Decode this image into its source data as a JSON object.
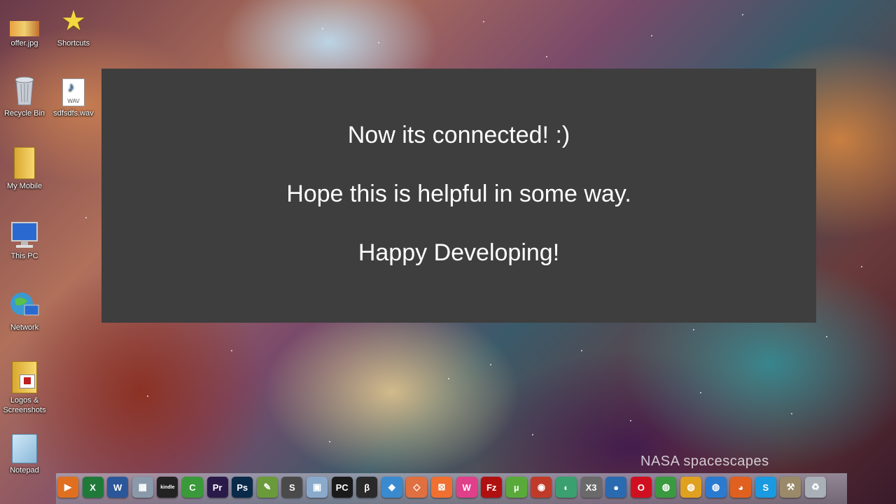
{
  "desktop": {
    "icons": [
      {
        "label": "offer.jpg"
      },
      {
        "label": "Shortcuts"
      },
      {
        "label": "Recycle Bin"
      },
      {
        "label": "sdfsdfs.wav"
      },
      {
        "label": "My Mobile"
      },
      {
        "label": "This PC"
      },
      {
        "label": "Network"
      },
      {
        "label": "Logos & Screenshots"
      },
      {
        "label": "Notepad"
      }
    ],
    "wav_badge": "WAV"
  },
  "overlay": {
    "line1": "Now its connected! :)",
    "line2": "Hope this is helpful in some way.",
    "line3": "Happy Developing!"
  },
  "watermark": "NASA spacescapes",
  "dock": {
    "items": [
      {
        "name": "media-player-icon",
        "text": "▶",
        "color": "#e07020"
      },
      {
        "name": "excel-icon",
        "text": "X",
        "color": "#1f7a3a"
      },
      {
        "name": "word-icon",
        "text": "W",
        "color": "#2b579a"
      },
      {
        "name": "calculator-icon",
        "text": "▦",
        "color": "#8a9aaa"
      },
      {
        "name": "kindle-icon",
        "text": "kindle",
        "color": "#222222"
      },
      {
        "name": "camtasia-icon",
        "text": "C",
        "color": "#3a9a3a"
      },
      {
        "name": "premiere-icon",
        "text": "Pr",
        "color": "#2a1a4a"
      },
      {
        "name": "photoshop-icon",
        "text": "Ps",
        "color": "#0a2a4a"
      },
      {
        "name": "notepad-plus-icon",
        "text": "✎",
        "color": "#6a9a3a"
      },
      {
        "name": "sublime-icon",
        "text": "S",
        "color": "#4a4a4a"
      },
      {
        "name": "box-icon",
        "text": "▣",
        "color": "#8aaacc"
      },
      {
        "name": "pycharm-icon",
        "text": "PC",
        "color": "#1a1a1a"
      },
      {
        "name": "brackets-icon",
        "text": "β",
        "color": "#2a2a2a"
      },
      {
        "name": "dolphin-icon",
        "text": "◆",
        "color": "#3a8ad0"
      },
      {
        "name": "git-icon",
        "text": "◇",
        "color": "#e07040"
      },
      {
        "name": "xampp-icon",
        "text": "⊠",
        "color": "#f07030"
      },
      {
        "name": "wamp-icon",
        "text": "W",
        "color": "#e0408a"
      },
      {
        "name": "filezilla-icon",
        "text": "Fz",
        "color": "#b01010"
      },
      {
        "name": "utorrent-icon",
        "text": "µ",
        "color": "#5aaa3a"
      },
      {
        "name": "firestorm-icon",
        "text": "◉",
        "color": "#c03a2a"
      },
      {
        "name": "curve-icon",
        "text": "◐",
        "color": "#3aa070"
      },
      {
        "name": "x3-icon",
        "text": "X3",
        "color": "#6a6a6a"
      },
      {
        "name": "google-earth-icon",
        "text": "●",
        "color": "#2a6ab0"
      },
      {
        "name": "opera-icon",
        "text": "O",
        "color": "#d01020"
      },
      {
        "name": "chrome-icon",
        "text": "◍",
        "color": "#3a9a40"
      },
      {
        "name": "chrome-canary-icon",
        "text": "◍",
        "color": "#e0a020"
      },
      {
        "name": "chrome-beta-icon",
        "text": "◍",
        "color": "#2a7ad0"
      },
      {
        "name": "firefox-icon",
        "text": "◕",
        "color": "#e06020"
      },
      {
        "name": "skype-icon",
        "text": "S",
        "color": "#1a9ae0"
      },
      {
        "name": "tools-icon",
        "text": "⚒",
        "color": "#9a8a6a"
      },
      {
        "name": "recycle-bin-dock-icon",
        "text": "♻",
        "color": "#aab0b8"
      }
    ]
  }
}
